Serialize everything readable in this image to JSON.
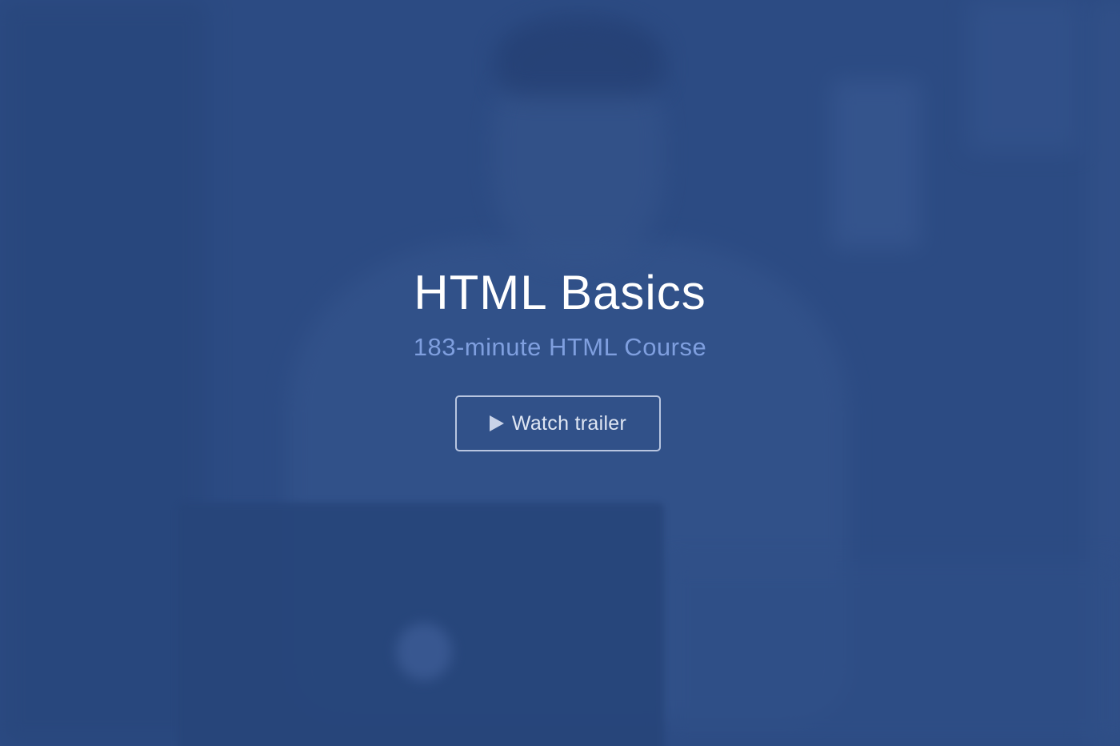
{
  "hero": {
    "title": "HTML Basics",
    "subtitle": "183-minute HTML Course",
    "cta": {
      "label": "Watch trailer",
      "icon": "play-icon"
    }
  },
  "colors": {
    "background": "#2c4b83",
    "title": "#ffffff",
    "subtitle": "#7f9fdf",
    "button_border": "#b8c5e0",
    "button_text": "#dfe6f3"
  }
}
